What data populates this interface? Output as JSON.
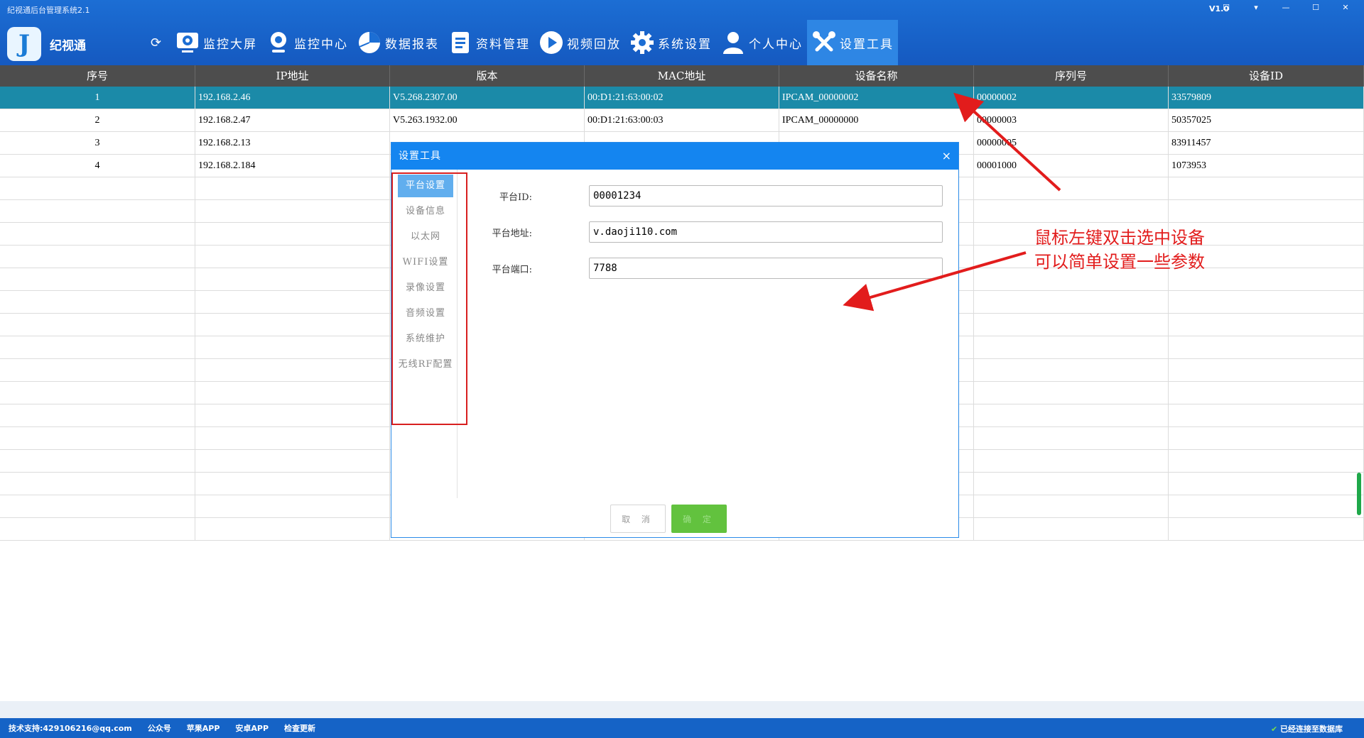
{
  "window": {
    "title": "纪视通后台管理系统2.1",
    "version": "V1.0",
    "controls": [
      "☐",
      "▾",
      "—",
      "☐",
      "✕"
    ]
  },
  "brand": {
    "logo_letter": "J",
    "name": "纪视通"
  },
  "nav": {
    "refresh_icon": "refresh-icon",
    "items": [
      {
        "label": "监控大屏",
        "icon": "monitor-screen-icon"
      },
      {
        "label": "监控中心",
        "icon": "camera-icon"
      },
      {
        "label": "数据报表",
        "icon": "pie-chart-icon"
      },
      {
        "label": "资料管理",
        "icon": "document-icon"
      },
      {
        "label": "视频回放",
        "icon": "play-icon"
      },
      {
        "label": "系统设置",
        "icon": "gear-icon"
      },
      {
        "label": "个人中心",
        "icon": "user-icon"
      },
      {
        "label": "设置工具",
        "icon": "tools-icon",
        "active": true
      }
    ]
  },
  "table": {
    "headers": [
      "序号",
      "IP地址",
      "版本",
      "MAC地址",
      "设备名称",
      "序列号",
      "设备ID"
    ],
    "rows": [
      [
        "1",
        "192.168.2.46",
        "V5.268.2307.00",
        "00:D1:21:63:00:02",
        "IPCAM_00000002",
        "00000002",
        "33579809"
      ],
      [
        "2",
        "192.168.2.47",
        "V5.263.1932.00",
        "00:D1:21:63:00:03",
        "IPCAM_00000000",
        "00000003",
        "50357025"
      ],
      [
        "3",
        "192.168.2.13",
        "",
        "",
        "",
        "00000005",
        "83911457"
      ],
      [
        "4",
        "192.168.2.184",
        "",
        "",
        "",
        "00001000",
        "1073953"
      ]
    ],
    "selected_row": 0
  },
  "dialog": {
    "title": "设置工具",
    "close": "×",
    "tabs": [
      "平台设置",
      "设备信息",
      "以太网",
      "WIFI设置",
      "录像设置",
      "音频设置",
      "系统维护",
      "无线RF配置"
    ],
    "active_tab": 0,
    "fields": [
      {
        "label": "平台ID:",
        "value": "00001234"
      },
      {
        "label": "平台地址:",
        "value": "v.daoji110.com"
      },
      {
        "label": "平台端口:",
        "value": "7788"
      }
    ],
    "cancel": "取 消",
    "ok": "确 定"
  },
  "annotation": {
    "line1": "鼠标左键双击选中设备",
    "line2": "可以简单设置一些参数",
    "color": "#e21c1c"
  },
  "statusbar": {
    "items": [
      "技术支持:429106216@qq.com",
      "公众号",
      "苹果APP",
      "安卓APP",
      "检查更新"
    ],
    "connection": "已经连接至数据库"
  },
  "colors": {
    "accent": "#1485f0",
    "selected_row": "#1b8aa8",
    "ok_button": "#62c23e"
  }
}
